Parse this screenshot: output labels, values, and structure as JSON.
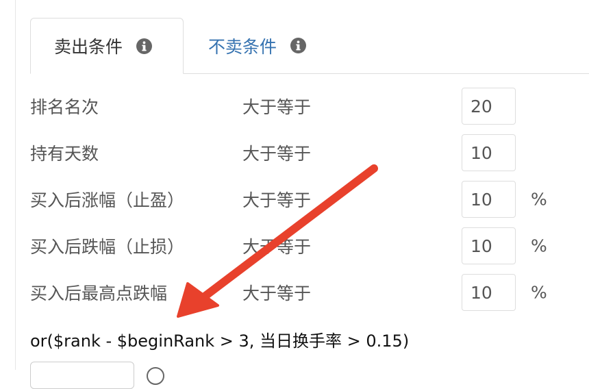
{
  "tabs": [
    {
      "label": "卖出条件",
      "active": true,
      "icon": "info-icon"
    },
    {
      "label": "不卖条件",
      "active": false,
      "icon": "info-icon"
    }
  ],
  "rows": [
    {
      "label": "排名名次",
      "operator": "大于等于",
      "value": "20",
      "unit": ""
    },
    {
      "label": "持有天数",
      "operator": "大于等于",
      "value": "10",
      "unit": ""
    },
    {
      "label": "买入后涨幅（止盈）",
      "operator": "大于等于",
      "value": "10",
      "unit": "%"
    },
    {
      "label": "买入后跌幅（止损）",
      "operator": "大于等于",
      "value": "10",
      "unit": "%"
    },
    {
      "label": "买入后最高点跌幅",
      "operator": "大于等于",
      "value": "10",
      "unit": "%"
    }
  ],
  "formula": "or($rank - $beginRank > 3, 当日换手率 > 0.15)",
  "colors": {
    "active_tab_text": "#333333",
    "inactive_tab_text": "#3572b0",
    "annotation_arrow": "#e8412c"
  }
}
